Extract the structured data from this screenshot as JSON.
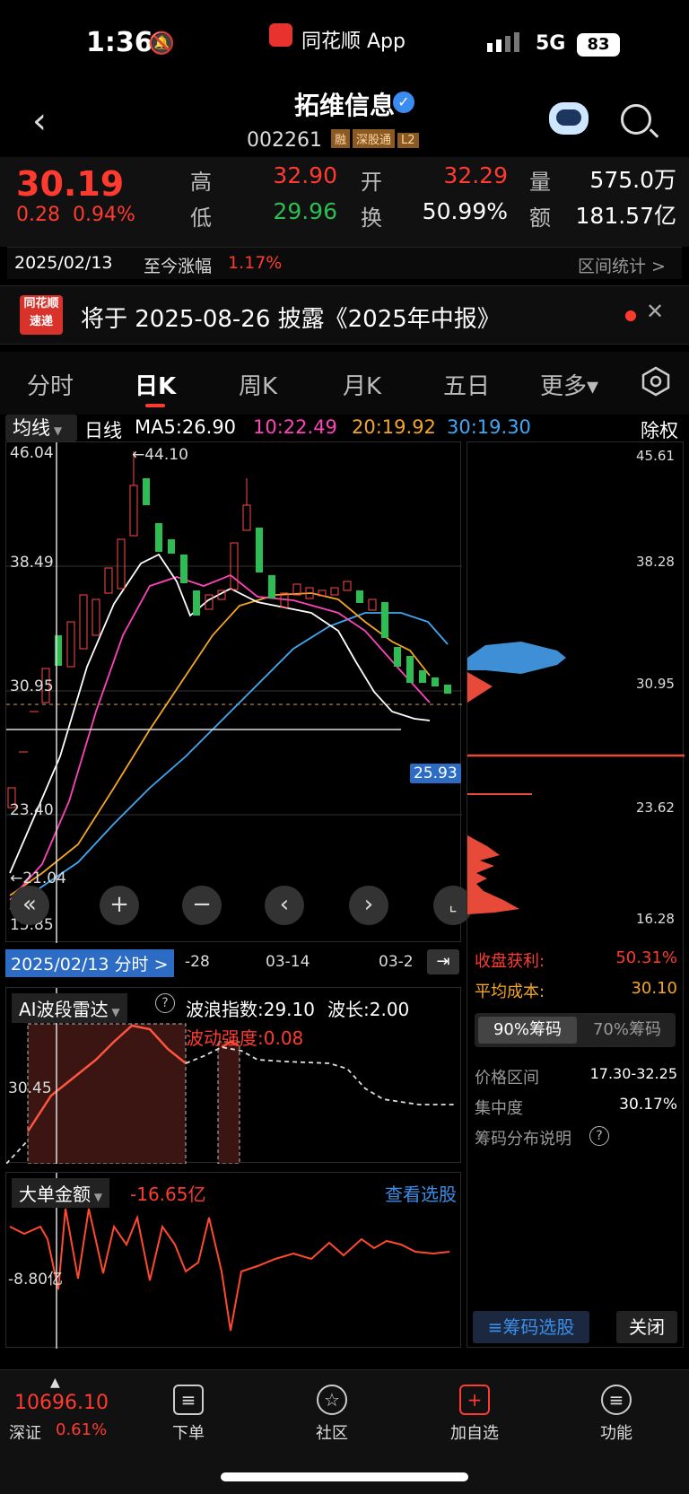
{
  "status": {
    "time": "1:36",
    "app": "同花顺 App",
    "network": "5G",
    "battery": "83"
  },
  "nav": {
    "title": "拓维信息",
    "code": "002261",
    "tags": [
      "融",
      "深股通",
      "L2"
    ]
  },
  "quote": {
    "price": "30.19",
    "change": "0.28",
    "change_pct": "0.94%",
    "high_label": "高",
    "high": "32.90",
    "low_label": "低",
    "low": "29.96",
    "open_label": "开",
    "open": "32.29",
    "turnover_label": "换",
    "turnover": "50.99%",
    "volume_label": "量",
    "volume": "575.0万",
    "amount_label": "额",
    "amount": "181.57亿"
  },
  "datebar": {
    "date": "2025/02/13",
    "since_label": "至今涨幅",
    "since_value": "1.17%",
    "stats_link": "区间统计 >"
  },
  "notice": {
    "logo_top": "同花顺",
    "logo_bottom": "速递",
    "text": "将于 2025-08-26 披露《2025年中报》"
  },
  "tabs": [
    "分时",
    "日K",
    "周K",
    "月K",
    "五日",
    "更多▾"
  ],
  "ma": {
    "select": "均线",
    "period": "日线",
    "ma5": "MA5:26.90",
    "ma10": "10:22.49",
    "ma20": "20:19.92",
    "ma30": "30:19.30",
    "adjust": "除权"
  },
  "kchart": {
    "yticks": [
      "46.04",
      "38.49",
      "30.95",
      "23.40",
      "15.85"
    ],
    "max_label": "←44.10",
    "min_label": "←21.04",
    "cursor_price": "25.93",
    "xlabels": [
      "-28",
      "03-14",
      "03-2"
    ],
    "cursor_date": "2025/02/13 分时 >"
  },
  "chips": {
    "yticks": [
      "45.61",
      "38.28",
      "30.95",
      "23.62",
      "16.28"
    ],
    "profit_label": "收盘获利:",
    "profit": "50.31%",
    "cost_label": "平均成本:",
    "cost": "30.10",
    "btn_90": "90%筹码",
    "btn_70": "70%筹码",
    "range_label": "价格区间",
    "range": "17.30-32.25",
    "conc_label": "集中度",
    "conc": "30.17%",
    "explain_label": "筹码分布说明",
    "select_btn": "筹码选股",
    "close_btn": "关闭"
  },
  "wave": {
    "select": "AI波段雷达",
    "index": "波浪指数:29.10",
    "length": "波长:2.00",
    "strength": "波动强度:0.08",
    "ytick": "30.45"
  },
  "bigorder": {
    "select": "大单金额",
    "value": "-16.65亿",
    "link": "查看选股",
    "ytick": "-8.80亿"
  },
  "bottom": {
    "index_value": "10696.10",
    "index_name": "深证",
    "index_pct": "0.61%",
    "items": [
      "下单",
      "社区",
      "加自选",
      "功能"
    ]
  }
}
